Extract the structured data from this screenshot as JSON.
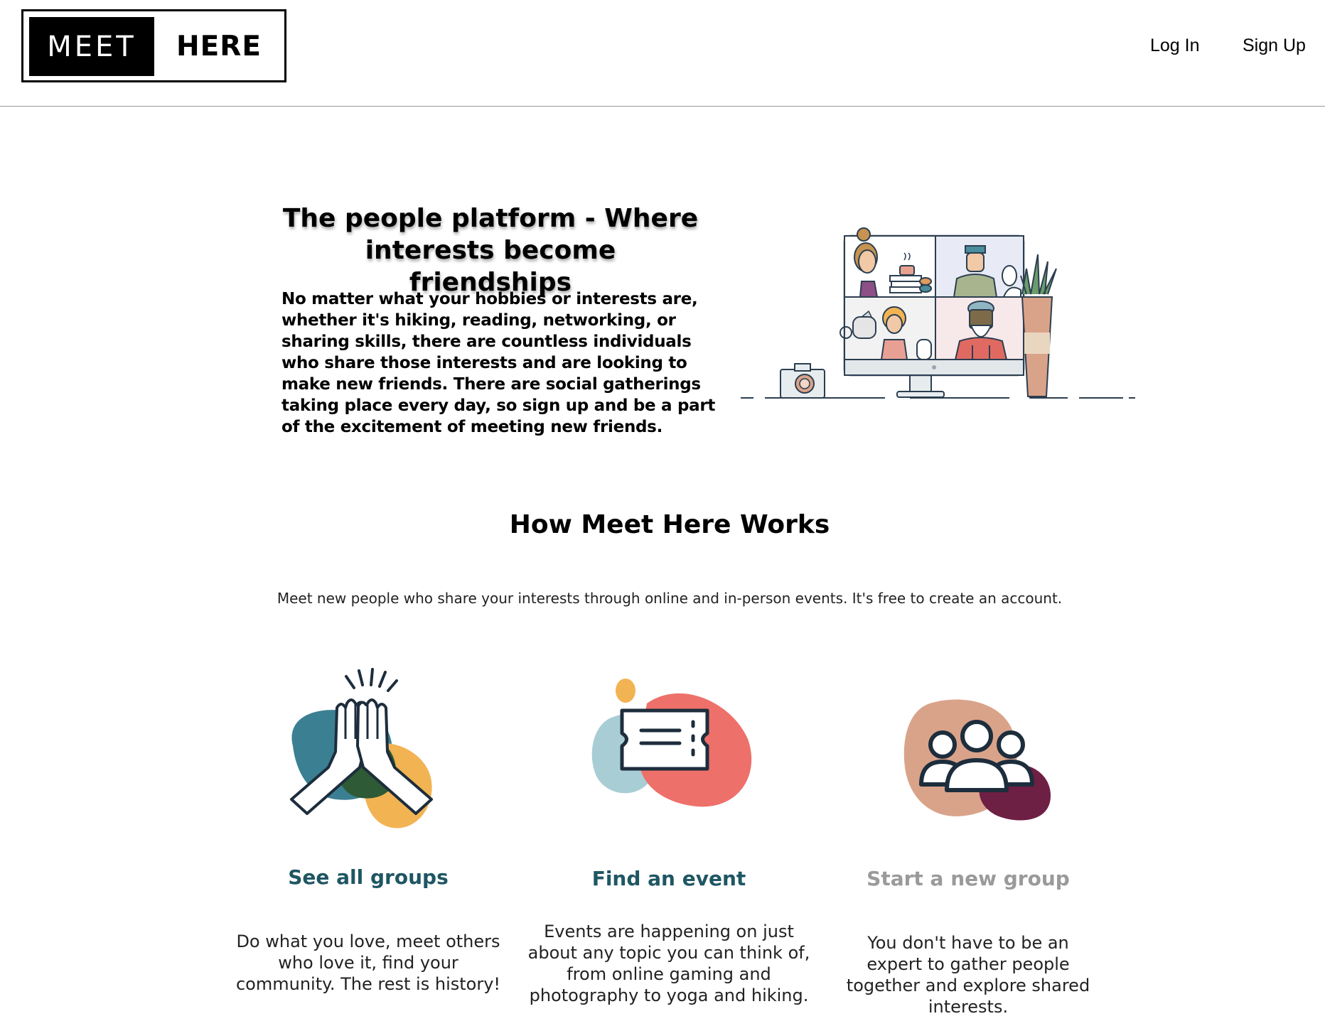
{
  "header": {
    "logo_left": "MEET",
    "logo_right": "HERE",
    "nav": {
      "login_label": "Log In",
      "signup_label": "Sign Up"
    }
  },
  "hero": {
    "title": "The people platform - Where interests become friendships",
    "text": "No matter what your hobbies or interests are, whether it's hiking, reading, networking, or sharing skills, there are countless individuals who share those interests and are looking to make new friends. There are social gatherings taking place every day, so sign up and be a part of the excitement of meeting new friends.",
    "illustration_icon": "video-call-illustration"
  },
  "how_it_works": {
    "title": "How Meet Here Works",
    "subtitle": "Meet new people who share your interests through online and in-person events. It's free to create an account.",
    "cards": [
      {
        "icon": "high-five-icon",
        "title": "See all groups",
        "title_color": "#1f5663",
        "description": "Do what you love, meet others who love it, find your community. The rest is history!"
      },
      {
        "icon": "ticket-icon",
        "title": "Find an event",
        "title_color": "#1f5663",
        "description": "Events are happening on just about any topic you can think of, from online gaming and photography to yoga and hiking."
      },
      {
        "icon": "group-people-icon",
        "title": "Start a new group",
        "title_color": "#9a9a9a",
        "description": "You don't have to be an expert to gather people together and explore shared interests."
      }
    ]
  },
  "colors": {
    "teal": "#3b7f93",
    "dark_green": "#2e5a35",
    "yellow": "#f2b352",
    "coral": "#ee706a",
    "light_blue": "#a8cdd4",
    "tan": "#d9a38a",
    "plum": "#6e1f44",
    "navy": "#1d2d3c"
  }
}
